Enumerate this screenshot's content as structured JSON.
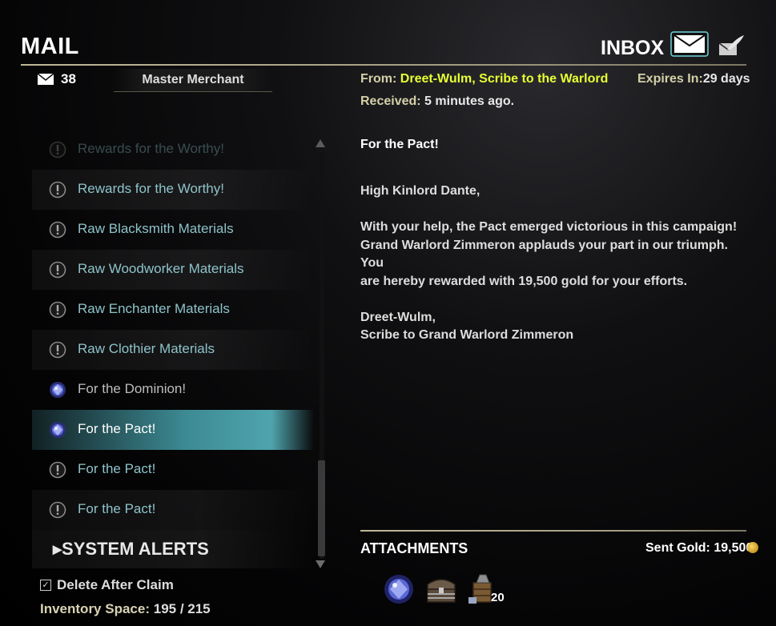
{
  "header": {
    "title": "MAIL",
    "inbox_label": "INBOX",
    "mail_count": "38",
    "merchant_label": "Master Merchant"
  },
  "mail_list": [
    {
      "label": "Rewards for the Worthy!",
      "icon": "alert-icon",
      "state": "faded"
    },
    {
      "label": "Rewards for the Worthy!",
      "icon": "alert-icon",
      "state": "unread"
    },
    {
      "label": "Raw Blacksmith Materials",
      "icon": "alert-icon",
      "state": "unread"
    },
    {
      "label": "Raw Woodworker Materials",
      "icon": "alert-icon",
      "state": "unread"
    },
    {
      "label": "Raw Enchanter Materials",
      "icon": "alert-icon",
      "state": "unread"
    },
    {
      "label": "Raw Clothier Materials",
      "icon": "alert-icon",
      "state": "unread"
    },
    {
      "label": "For the Dominion!",
      "icon": "gem-icon",
      "state": "read"
    },
    {
      "label": "For the Pact!",
      "icon": "gem-icon",
      "state": "selected"
    },
    {
      "label": "For the Pact!",
      "icon": "alert-icon",
      "state": "unread"
    },
    {
      "label": "For the Pact!",
      "icon": "alert-icon",
      "state": "unread"
    }
  ],
  "system_alerts_label": "SYSTEM ALERTS",
  "footer": {
    "delete_after_claim": "Delete After Claim",
    "inventory_label": "Inventory Space:",
    "inventory_value": "195 / 215"
  },
  "message": {
    "from_label": "From:",
    "from_value": "Dreet-Wulm, Scribe to the Warlord",
    "expires_label": "Expires In:",
    "expires_value": "29 days",
    "received_label": "Received:",
    "received_value": "5 minutes ago.",
    "subject": "For the Pact!",
    "greeting": "High Kinlord Dante,",
    "body_lines": [
      "With your help, the Pact emerged victorious in this campaign!",
      "Grand Warlord Zimmeron applauds your part in our triumph. You",
      "are hereby rewarded with 19,500 gold for your efforts."
    ],
    "signature_lines": [
      "Dreet-Wulm,",
      "Scribe to Grand Warlord Zimmeron"
    ]
  },
  "attachments": {
    "title": "ATTACHMENTS",
    "sent_gold_label": "Sent Gold:",
    "sent_gold_value": "19,500",
    "items": [
      {
        "icon": "gem-icon"
      },
      {
        "icon": "chest-icon"
      },
      {
        "icon": "siege-repair-kit-icon",
        "count": "20"
      }
    ]
  },
  "colors": {
    "unread_text": "#8ec3c9",
    "highlight_yellow": "#e8ff33",
    "selected_row": "#4fa4ad"
  }
}
